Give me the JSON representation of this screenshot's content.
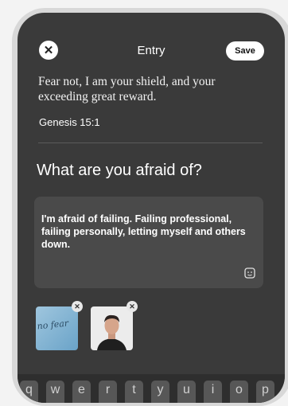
{
  "header": {
    "close_icon": "close-icon",
    "title": "Entry",
    "save_label": "Save"
  },
  "verse": {
    "text": "Fear not, I am your shield, and your exceeding great reward.",
    "reference": "Genesis 15:1"
  },
  "prompt": "What are you afraid of?",
  "entry": {
    "text": "I'm afraid of failing. Failing professional, failing personally, letting myself and others down.",
    "sticker_icon": "sticker-icon"
  },
  "attachments": [
    {
      "type": "photo",
      "alt": "handwritten note photo",
      "visible_text": "no fear"
    },
    {
      "type": "photo",
      "alt": "portrait photo"
    }
  ],
  "keyboard": {
    "keys": [
      "q",
      "w",
      "e",
      "r",
      "t",
      "y",
      "u",
      "i",
      "o",
      "p"
    ]
  }
}
